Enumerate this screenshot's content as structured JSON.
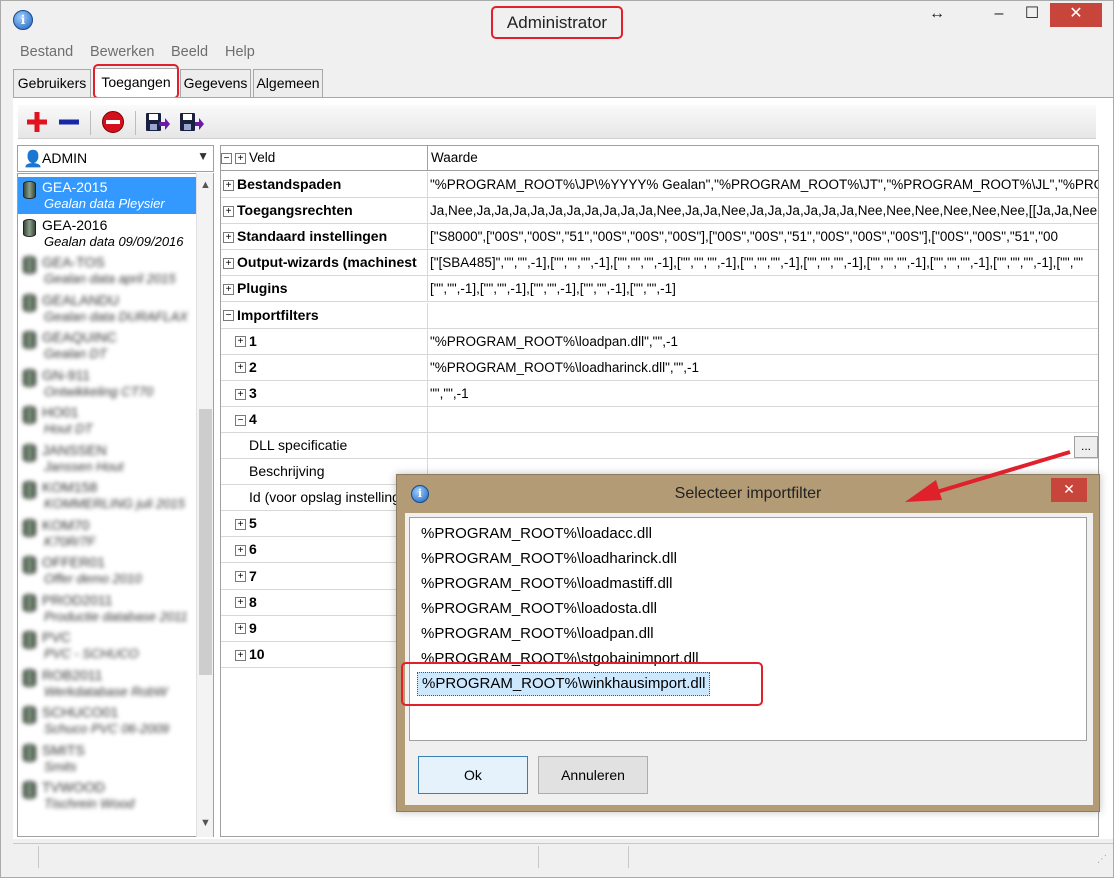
{
  "window": {
    "title": "Administrator",
    "icon": "info-icon"
  },
  "menu": [
    "Bestand",
    "Bewerken",
    "Beeld",
    "Help"
  ],
  "tabs": [
    "Gebruikers",
    "Toegangen",
    "Gegevens",
    "Algemeen"
  ],
  "active_tab": "Toegangen",
  "toolbar_icons": [
    "add-icon",
    "remove-icon",
    "delete-icon",
    "export-icon",
    "import-icon"
  ],
  "user_select": {
    "value": "ADMIN"
  },
  "databases": [
    {
      "name": "GEA-2015",
      "desc": "Gealan data Pleysier",
      "selected": true,
      "blurred": false
    },
    {
      "name": "GEA-2016",
      "desc": "Gealan data 09/09/2016",
      "selected": false,
      "blurred": false
    },
    {
      "name": "GEA-TOS",
      "desc": "Gealan data april 2015",
      "selected": false,
      "blurred": true
    },
    {
      "name": "GEALANDU",
      "desc": "Gealan data DURAFLAX",
      "selected": false,
      "blurred": true
    },
    {
      "name": "GEAQUINC",
      "desc": "Gealan DT",
      "selected": false,
      "blurred": true
    },
    {
      "name": "GN-911",
      "desc": "Ontwikkeling CT70",
      "selected": false,
      "blurred": true
    },
    {
      "name": "HO01",
      "desc": "Hout DT",
      "selected": false,
      "blurred": true
    },
    {
      "name": "JANSSEN",
      "desc": "Janssen Hout",
      "selected": false,
      "blurred": true
    },
    {
      "name": "KOM158",
      "desc": "KOMMERLING juli 2015",
      "selected": false,
      "blurred": true
    },
    {
      "name": "KOM70",
      "desc": "K70R/7F",
      "selected": false,
      "blurred": true
    },
    {
      "name": "OFFER01",
      "desc": "Offer demo 2010",
      "selected": false,
      "blurred": true
    },
    {
      "name": "PROD2011",
      "desc": "Productie database 2011",
      "selected": false,
      "blurred": true
    },
    {
      "name": "PVC",
      "desc": "PVC - SCHUCO",
      "selected": false,
      "blurred": true
    },
    {
      "name": "ROB2011",
      "desc": "Werkdatabase RobW",
      "selected": false,
      "blurred": true
    },
    {
      "name": "SCHUCO01",
      "desc": "Schuco PVC 06-2009",
      "selected": false,
      "blurred": true
    },
    {
      "name": "SMITS",
      "desc": "Smits",
      "selected": false,
      "blurred": true
    },
    {
      "name": "TVWOOD",
      "desc": "Tischrein Wood",
      "selected": false,
      "blurred": true
    }
  ],
  "grid": {
    "header": {
      "col1": "Veld",
      "col2": "Waarde"
    },
    "rows": [
      {
        "label": "Bestandspaden",
        "value": "\"%PROGRAM_ROOT%\\JP\\%YYYY% Gealan\",\"%PROGRAM_ROOT%\\JT\",\"%PROGRAM_ROOT%\\JL\",\"%PROGRAM_ROOT%",
        "bold": true,
        "indent": 0,
        "expander": "+"
      },
      {
        "label": "Toegangsrechten",
        "value": "Ja,Nee,Ja,Ja,Ja,Ja,Ja,Ja,Ja,Ja,Ja,Ja,Nee,Ja,Ja,Nee,Ja,Ja,Ja,Ja,Ja,Ja,Nee,Nee,Nee,Nee,Nee,Nee,[[Ja,Ja,Nee,\"",
        "bold": true,
        "indent": 0,
        "expander": "+"
      },
      {
        "label": "Standaard instellingen",
        "value": "[\"S8000\",[\"00S\",\"00S\",\"51\",\"00S\",\"00S\",\"00S\"],[\"00S\",\"00S\",\"51\",\"00S\",\"00S\",\"00S\"],[\"00S\",\"00S\",\"51\",\"00",
        "bold": true,
        "indent": 0,
        "expander": "+"
      },
      {
        "label": "Output-wizards (machinest",
        "value": "[\"[SBA485]\",\"\",\"\",-1],[\"\",\"\",\"\",-1],[\"\",\"\",\"\",-1],[\"\",\"\",\"\",-1],[\"\",\"\",\"\",-1],[\"\",\"\",\"\",-1],[\"\",\"\",\"\",-1],[\"\",\"\",\"\",-1],[\"\",\"\",\"\",-1],[\"\",\"\"",
        "bold": true,
        "indent": 0,
        "expander": "+"
      },
      {
        "label": "Plugins",
        "value": "[\"\",\"\",-1],[\"\",\"\",-1],[\"\",\"\",-1],[\"\",\"\",-1],[\"\",\"\",-1]",
        "bold": true,
        "indent": 0,
        "expander": "+"
      },
      {
        "label": "Importfilters",
        "value": "",
        "bold": true,
        "indent": 0,
        "expander": "−"
      },
      {
        "label": "1",
        "value": "\"%PROGRAM_ROOT%\\loadpan.dll\",\"\",-1",
        "bold": true,
        "indent": 1,
        "expander": "+"
      },
      {
        "label": "2",
        "value": "\"%PROGRAM_ROOT%\\loadharinck.dll\",\"\",-1",
        "bold": true,
        "indent": 1,
        "expander": "+"
      },
      {
        "label": "3",
        "value": "\"\",\"\",-1",
        "bold": true,
        "indent": 1,
        "expander": "+"
      },
      {
        "label": "4",
        "value": "",
        "bold": true,
        "indent": 1,
        "expander": "−"
      },
      {
        "label": "DLL specificatie",
        "value": "",
        "bold": false,
        "indent": 2,
        "expander": ""
      },
      {
        "label": "Beschrijving",
        "value": "",
        "bold": false,
        "indent": 2,
        "expander": ""
      },
      {
        "label": "Id (voor opslag instellinge",
        "value": "",
        "bold": false,
        "indent": 2,
        "expander": ""
      },
      {
        "label": "5",
        "value": "",
        "bold": true,
        "indent": 1,
        "expander": "+"
      },
      {
        "label": "6",
        "value": "",
        "bold": true,
        "indent": 1,
        "expander": "+"
      },
      {
        "label": "7",
        "value": "",
        "bold": true,
        "indent": 1,
        "expander": "+"
      },
      {
        "label": "8",
        "value": "",
        "bold": true,
        "indent": 1,
        "expander": "+"
      },
      {
        "label": "9",
        "value": "",
        "bold": true,
        "indent": 1,
        "expander": "+"
      },
      {
        "label": "10",
        "value": "",
        "bold": true,
        "indent": 1,
        "expander": "+"
      }
    ],
    "ellipsis_label": "..."
  },
  "dialog": {
    "title": "Selecteer importfilter",
    "items": [
      "%PROGRAM_ROOT%\\loadacc.dll",
      "%PROGRAM_ROOT%\\loadharinck.dll",
      "%PROGRAM_ROOT%\\loadmastiff.dll",
      "%PROGRAM_ROOT%\\loadosta.dll",
      "%PROGRAM_ROOT%\\loadpan.dll",
      "%PROGRAM_ROOT%\\stgobainimport.dll",
      "%PROGRAM_ROOT%\\winkhausimport.dll"
    ],
    "selected_index": 6,
    "ok_label": "Ok",
    "cancel_label": "Annuleren"
  },
  "colors": {
    "highlight_red": "#e0202a",
    "selection_blue": "#3399ff",
    "dialog_frame": "#b39b76",
    "close_red": "#c7453a"
  }
}
